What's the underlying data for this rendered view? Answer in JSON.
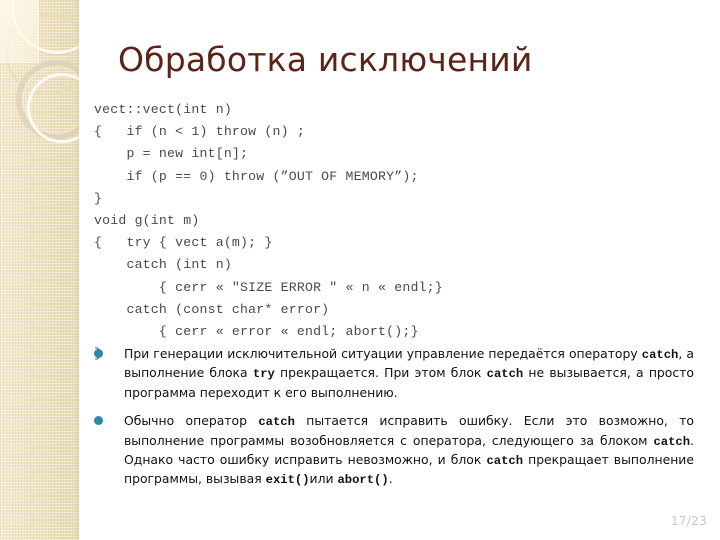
{
  "slide": {
    "title": "Обработка исключений",
    "page_number": "17/23",
    "accent_title_color": "#5C2318",
    "bullet_marker_color": "#2E86A8",
    "sidebar_color": "#F0E4C6",
    "code_text_color": "#4A4A4A"
  },
  "code_block": {
    "language": "cpp",
    "lines": [
      "vect::vect(int n)",
      "{   if (n < 1) throw (n) ;",
      "    p = new int[n];",
      "    if (p == 0) throw (”OUT OF MEMORY”);",
      "}",
      "void g(int m)",
      "{   try { vect a(m); }",
      "    catch (int n)",
      "        { cerr « \"SIZE ERROR \" « n « endl;}",
      "    catch (const char* error)",
      "        { cerr « error « endl; abort();}",
      "}"
    ]
  },
  "bullets": [
    {
      "parts": [
        {
          "text": "При генерации исключительной ситуации управление передаётся оператору ",
          "mono": false
        },
        {
          "text": "catch",
          "mono": true
        },
        {
          "text": ", а выполнение блока ",
          "mono": false
        },
        {
          "text": "try",
          "mono": true
        },
        {
          "text": " прекращается. При этом блок ",
          "mono": false
        },
        {
          "text": "catch",
          "mono": true
        },
        {
          "text": " не вызывается, а просто программа переходит к его выполнению.",
          "mono": false
        }
      ]
    },
    {
      "parts": [
        {
          "text": "Обычно оператор ",
          "mono": false
        },
        {
          "text": "catch",
          "mono": true
        },
        {
          "text": " пытается исправить ошибку. Если это возможно, то выполнение программы возобновляется с оператора, следующего за блоком ",
          "mono": false
        },
        {
          "text": "catch",
          "mono": true
        },
        {
          "text": ". Однако часто ошибку исправить невозможно, и блок ",
          "mono": false
        },
        {
          "text": "catch",
          "mono": true
        },
        {
          "text": " прекращает выполнение программы, вызывая ",
          "mono": false
        },
        {
          "text": "exit()",
          "mono": true
        },
        {
          "text": "или ",
          "mono": false
        },
        {
          "text": "abort()",
          "mono": true
        },
        {
          "text": ".",
          "mono": false
        }
      ]
    }
  ]
}
